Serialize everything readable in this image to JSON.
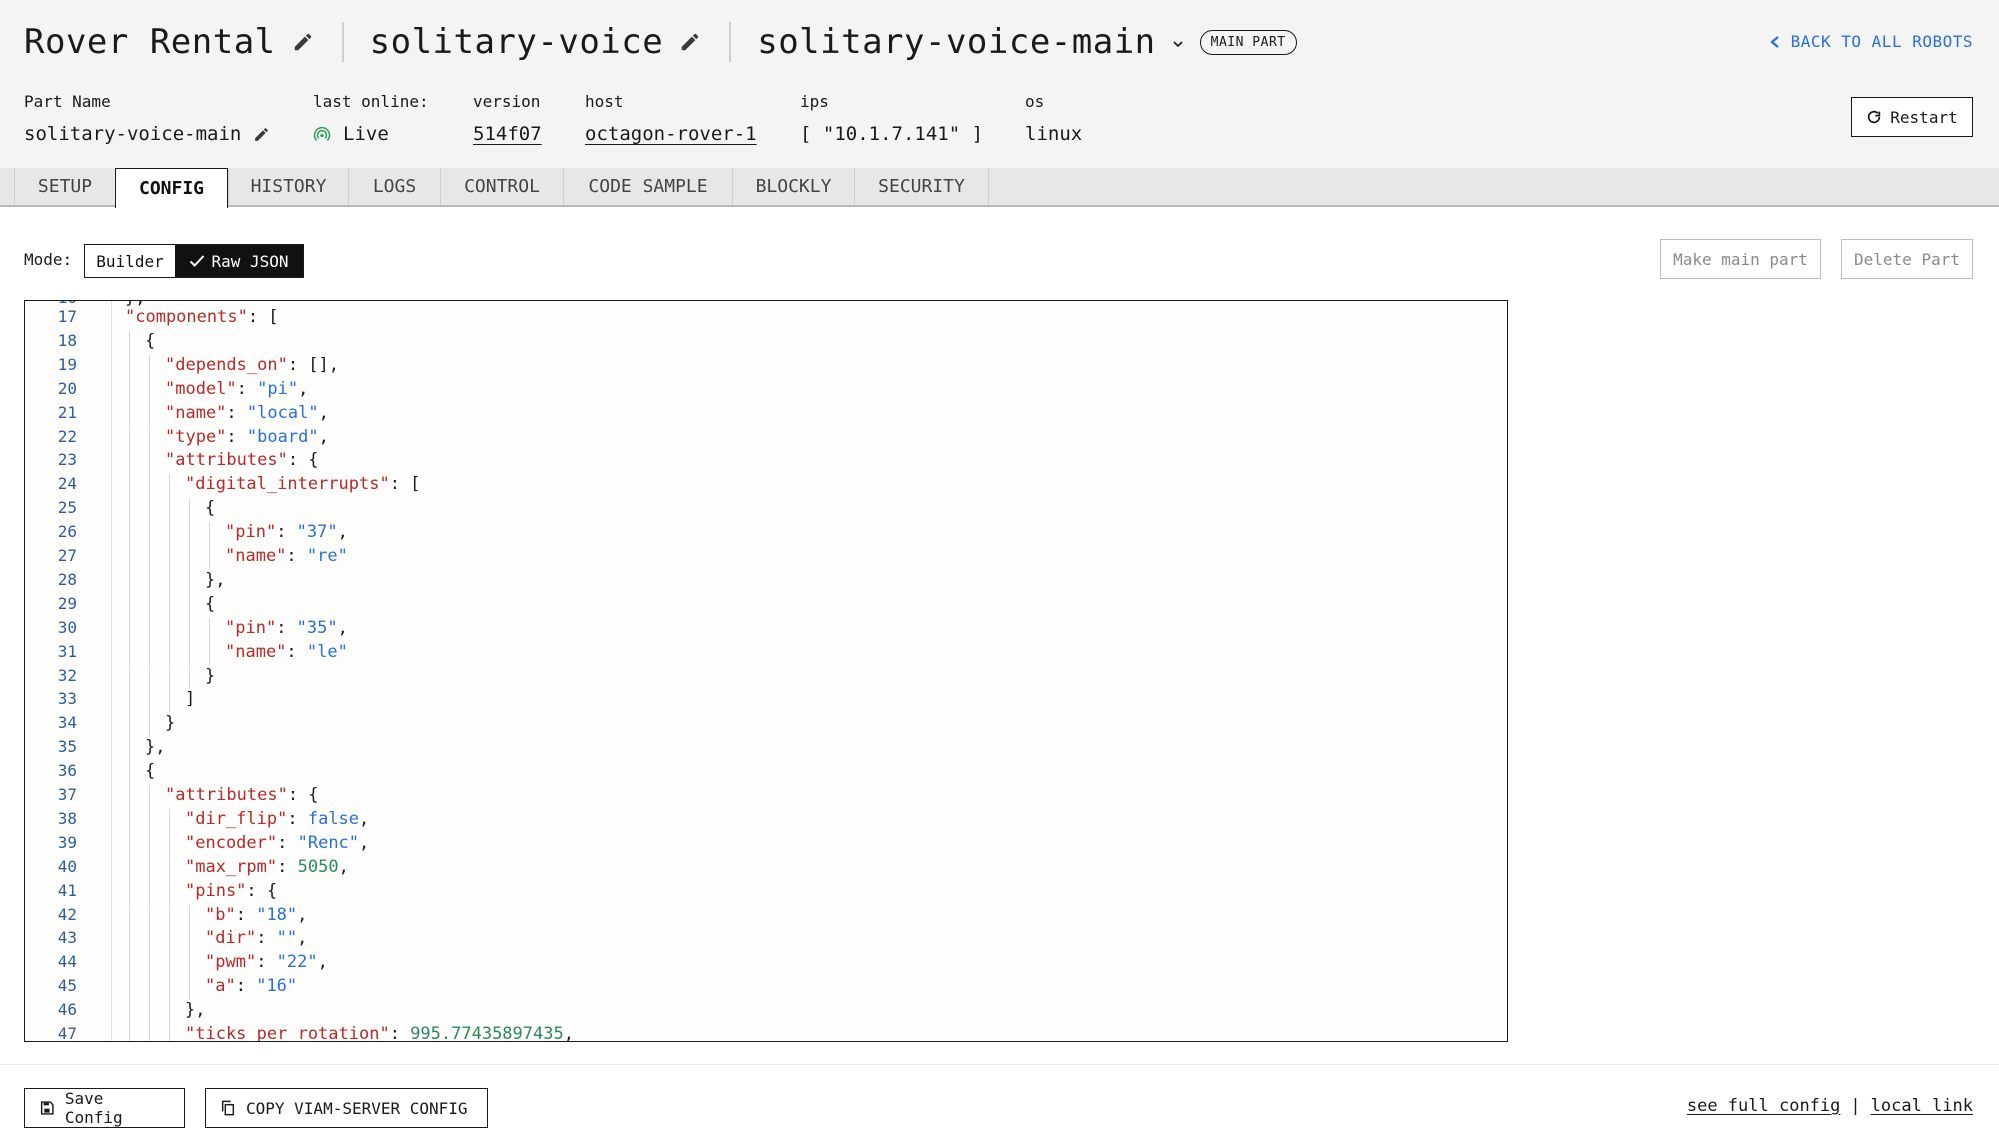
{
  "header": {
    "robot_name": "Rover Rental",
    "location_name": "solitary-voice",
    "part_name": "solitary-voice-main",
    "main_badge": "MAIN PART",
    "back_link": "BACK TO ALL ROBOTS",
    "icons": [
      "pencil-icon",
      "chevron-down-icon",
      "chevron-left-icon",
      "live-signal-icon",
      "refresh-icon"
    ]
  },
  "meta": {
    "part_name_label": "Part Name",
    "part_name_value": "solitary-voice-main",
    "last_online_label": "last online:",
    "last_online_value": "Live",
    "version_label": "version",
    "version_value": "514f07",
    "host_label": "host",
    "host_value": "octagon-rover-1",
    "ips_label": "ips",
    "ips_value": "[ \"10.1.7.141\" ]",
    "os_label": "os",
    "os_value": "linux",
    "restart_label": "Restart"
  },
  "tabs": [
    {
      "label": "SETUP"
    },
    {
      "label": "CONFIG",
      "active": true
    },
    {
      "label": "HISTORY"
    },
    {
      "label": "LOGS"
    },
    {
      "label": "CONTROL"
    },
    {
      "label": "CODE SAMPLE"
    },
    {
      "label": "BLOCKLY"
    },
    {
      "label": "SECURITY"
    }
  ],
  "mode": {
    "label": "Mode:",
    "builder": "Builder",
    "raw_json": "Raw JSON",
    "selected": "Raw JSON"
  },
  "actions": {
    "make_main_part": "Make main part",
    "delete_part": "Delete Part"
  },
  "editor": {
    "lines": [
      {
        "n": 17,
        "indent": 0,
        "t": [
          [
            "k",
            "\"components\""
          ],
          [
            "p",
            ": ["
          ]
        ]
      },
      {
        "n": 18,
        "indent": 1,
        "t": [
          [
            "p",
            "{"
          ]
        ]
      },
      {
        "n": 19,
        "indent": 2,
        "t": [
          [
            "k",
            "\"depends_on\""
          ],
          [
            "p",
            ": [],"
          ]
        ]
      },
      {
        "n": 20,
        "indent": 2,
        "t": [
          [
            "k",
            "\"model\""
          ],
          [
            "p",
            ": "
          ],
          [
            "s",
            "\"pi\""
          ],
          [
            "p",
            ","
          ]
        ]
      },
      {
        "n": 21,
        "indent": 2,
        "t": [
          [
            "k",
            "\"name\""
          ],
          [
            "p",
            ": "
          ],
          [
            "s",
            "\"local\""
          ],
          [
            "p",
            ","
          ]
        ]
      },
      {
        "n": 22,
        "indent": 2,
        "t": [
          [
            "k",
            "\"type\""
          ],
          [
            "p",
            ": "
          ],
          [
            "s",
            "\"board\""
          ],
          [
            "p",
            ","
          ]
        ]
      },
      {
        "n": 23,
        "indent": 2,
        "t": [
          [
            "k",
            "\"attributes\""
          ],
          [
            "p",
            ": {"
          ]
        ]
      },
      {
        "n": 24,
        "indent": 3,
        "t": [
          [
            "k",
            "\"digital_interrupts\""
          ],
          [
            "p",
            ": ["
          ]
        ]
      },
      {
        "n": 25,
        "indent": 4,
        "t": [
          [
            "p",
            "{"
          ]
        ]
      },
      {
        "n": 26,
        "indent": 5,
        "t": [
          [
            "k",
            "\"pin\""
          ],
          [
            "p",
            ": "
          ],
          [
            "s",
            "\"37\""
          ],
          [
            "p",
            ","
          ]
        ]
      },
      {
        "n": 27,
        "indent": 5,
        "t": [
          [
            "k",
            "\"name\""
          ],
          [
            "p",
            ": "
          ],
          [
            "s",
            "\"re\""
          ]
        ]
      },
      {
        "n": 28,
        "indent": 4,
        "t": [
          [
            "p",
            "},"
          ]
        ]
      },
      {
        "n": 29,
        "indent": 4,
        "t": [
          [
            "p",
            "{"
          ]
        ]
      },
      {
        "n": 30,
        "indent": 5,
        "t": [
          [
            "k",
            "\"pin\""
          ],
          [
            "p",
            ": "
          ],
          [
            "s",
            "\"35\""
          ],
          [
            "p",
            ","
          ]
        ]
      },
      {
        "n": 31,
        "indent": 5,
        "t": [
          [
            "k",
            "\"name\""
          ],
          [
            "p",
            ": "
          ],
          [
            "s",
            "\"le\""
          ]
        ]
      },
      {
        "n": 32,
        "indent": 4,
        "t": [
          [
            "p",
            "}"
          ]
        ]
      },
      {
        "n": 33,
        "indent": 3,
        "t": [
          [
            "p",
            "]"
          ]
        ]
      },
      {
        "n": 34,
        "indent": 2,
        "t": [
          [
            "p",
            "}"
          ]
        ]
      },
      {
        "n": 35,
        "indent": 1,
        "t": [
          [
            "p",
            "},"
          ]
        ]
      },
      {
        "n": 36,
        "indent": 1,
        "t": [
          [
            "p",
            "{"
          ]
        ]
      },
      {
        "n": 37,
        "indent": 2,
        "t": [
          [
            "k",
            "\"attributes\""
          ],
          [
            "p",
            ": {"
          ]
        ]
      },
      {
        "n": 38,
        "indent": 3,
        "t": [
          [
            "k",
            "\"dir_flip\""
          ],
          [
            "p",
            ": "
          ],
          [
            "b",
            "false"
          ],
          [
            "p",
            ","
          ]
        ]
      },
      {
        "n": 39,
        "indent": 3,
        "t": [
          [
            "k",
            "\"encoder\""
          ],
          [
            "p",
            ": "
          ],
          [
            "s",
            "\"Renc\""
          ],
          [
            "p",
            ","
          ]
        ]
      },
      {
        "n": 40,
        "indent": 3,
        "t": [
          [
            "k",
            "\"max_rpm\""
          ],
          [
            "p",
            ": "
          ],
          [
            "n",
            "5050"
          ],
          [
            "p",
            ","
          ]
        ]
      },
      {
        "n": 41,
        "indent": 3,
        "t": [
          [
            "k",
            "\"pins\""
          ],
          [
            "p",
            ": {"
          ]
        ]
      },
      {
        "n": 42,
        "indent": 4,
        "t": [
          [
            "k",
            "\"b\""
          ],
          [
            "p",
            ": "
          ],
          [
            "s",
            "\"18\""
          ],
          [
            "p",
            ","
          ]
        ]
      },
      {
        "n": 43,
        "indent": 4,
        "t": [
          [
            "k",
            "\"dir\""
          ],
          [
            "p",
            ": "
          ],
          [
            "s",
            "\"\""
          ],
          [
            "p",
            ","
          ]
        ]
      },
      {
        "n": 44,
        "indent": 4,
        "t": [
          [
            "k",
            "\"pwm\""
          ],
          [
            "p",
            ": "
          ],
          [
            "s",
            "\"22\""
          ],
          [
            "p",
            ","
          ]
        ]
      },
      {
        "n": 45,
        "indent": 4,
        "t": [
          [
            "k",
            "\"a\""
          ],
          [
            "p",
            ": "
          ],
          [
            "s",
            "\"16\""
          ]
        ]
      },
      {
        "n": 46,
        "indent": 3,
        "t": [
          [
            "p",
            "},"
          ]
        ]
      },
      {
        "n": 47,
        "indent": 3,
        "t": [
          [
            "k",
            "\"ticks_per_rotation\""
          ],
          [
            "p",
            ": "
          ],
          [
            "n",
            "995.77435897435"
          ],
          [
            "p",
            ","
          ]
        ]
      }
    ]
  },
  "footer": {
    "save_config": "Save Config",
    "copy_config": "COPY VIAM-SERVER CONFIG",
    "see_full_config": "see full config",
    "separator": "|",
    "local_link": "local link"
  }
}
